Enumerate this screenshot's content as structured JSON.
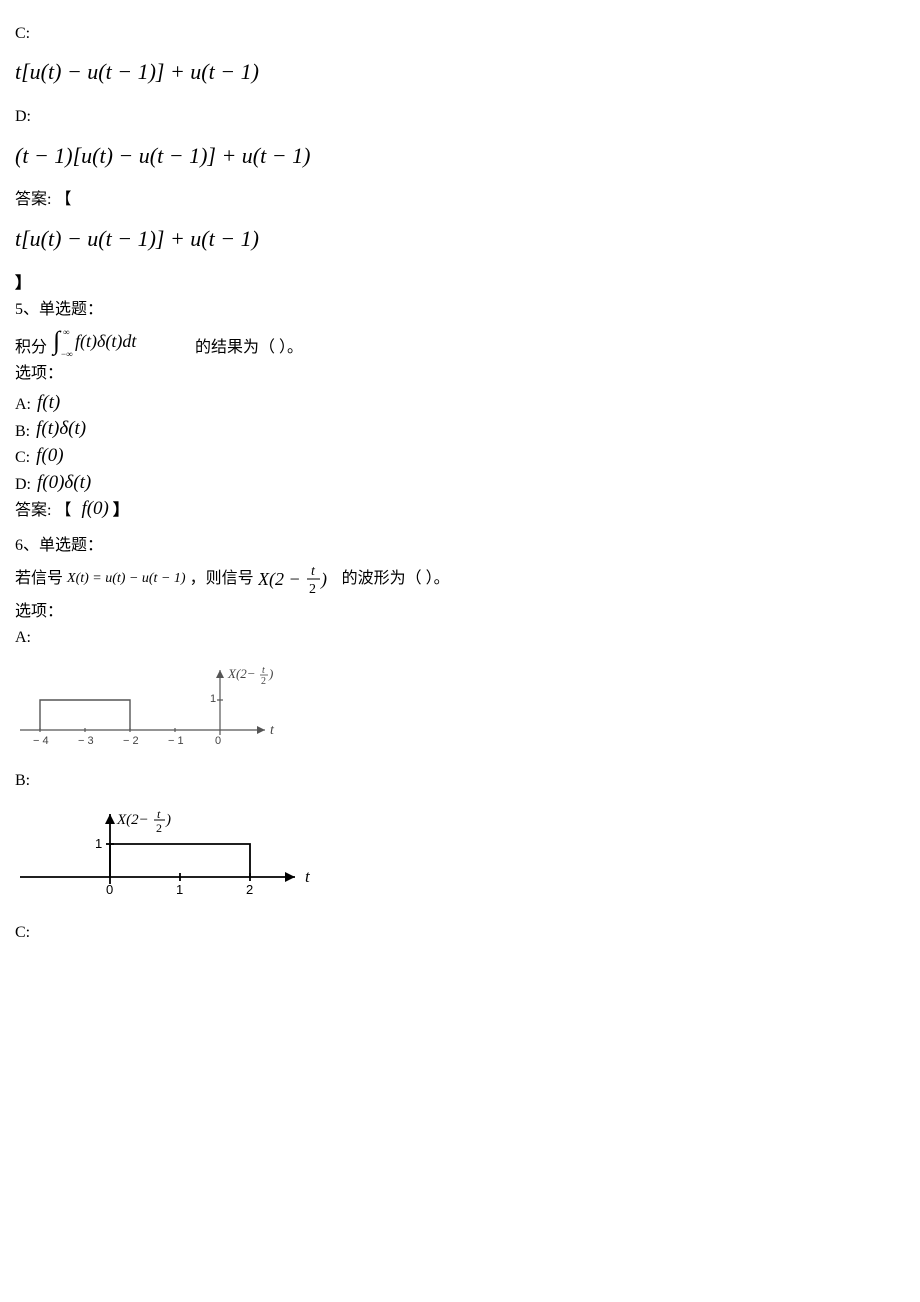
{
  "q4": {
    "optC_label": "C:",
    "optC_expr": "t[u(t) − u(t − 1)] + u(t − 1)",
    "optD_label": "D:",
    "optD_expr": "(t − 1)[u(t) − u(t − 1)] + u(t − 1)",
    "answer_label": "答案: 【",
    "answer_expr": "t[u(t) − u(t − 1)] + u(t − 1)",
    "answer_close": "】"
  },
  "q5": {
    "header": "5、单选题：",
    "stem_pre": "积分",
    "stem_integral": "∫−∞∞ f(t)δ(t)dt",
    "stem_post": "的结果为（ ）。",
    "options_label": "选项：",
    "A_label": "A:",
    "A_expr": "f(t)",
    "B_label": "B:",
    "B_expr": "f(t)δ(t)",
    "C_label": "C:",
    "C_expr": "f(0)",
    "D_label": "D:",
    "D_expr": "f(0)δ(t)",
    "answer_label": "答案: 【",
    "answer_expr": "f(0)",
    "answer_close": "】"
  },
  "q6": {
    "header": "6、单选题：",
    "stem_pre": "若信号",
    "stem_expr1": "X(t) = u(t) − u(t − 1)",
    "stem_mid": " ，则信号",
    "stem_expr2": "X(2 − t/2)",
    "stem_post": "的波形为（ ）。",
    "options_label": "选项：",
    "A_label": "A:",
    "B_label": "B:",
    "C_label": "C:"
  },
  "chart_data": [
    {
      "type": "line",
      "title": "X(2 − t/2)",
      "xlabel": "t",
      "ylabel": "",
      "xlim": [
        -4.5,
        0.8
      ],
      "ylim": [
        0,
        1.2
      ],
      "x_ticks": [
        -4,
        -3,
        -2,
        -1,
        0
      ],
      "y_ticks": [
        1
      ],
      "series": [
        {
          "name": "pulse",
          "x": [
            -4,
            -4,
            -2,
            -2
          ],
          "y": [
            0,
            1,
            1,
            0
          ]
        }
      ],
      "annotations": [
        "axis arrow at origin pointing up and right"
      ]
    },
    {
      "type": "line",
      "title": "X(2 − t/2)",
      "xlabel": "t",
      "ylabel": "",
      "xlim": [
        -1,
        3
      ],
      "ylim": [
        0,
        1.2
      ],
      "x_ticks": [
        0,
        1,
        2
      ],
      "y_ticks": [
        1
      ],
      "series": [
        {
          "name": "pulse",
          "x": [
            0,
            0,
            2,
            2
          ],
          "y": [
            0,
            1,
            1,
            0
          ]
        }
      ],
      "annotations": [
        "axis arrow at origin pointing up and right"
      ]
    }
  ]
}
